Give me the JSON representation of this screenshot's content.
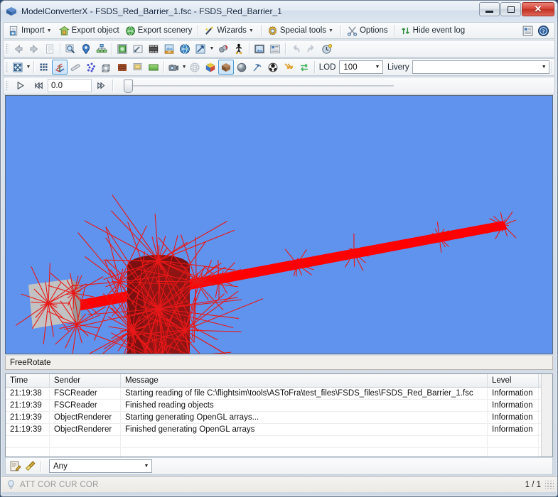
{
  "window": {
    "title": "ModelConverterX - FSDS_Red_Barrier_1.fsc - FSDS_Red_Barrier_1",
    "app_icon": "blue-cube-icon",
    "controls": {
      "minimize": "Minimize",
      "maximize": "Maximize",
      "close": "Close"
    }
  },
  "menubar": {
    "items": [
      {
        "label": "Import",
        "icon": "import-page-icon",
        "caret": true
      },
      {
        "label": "Export object",
        "icon": "export-object-icon",
        "caret": false
      },
      {
        "label": "Export scenery",
        "icon": "export-scenery-globe-icon",
        "caret": false
      },
      {
        "label": "Wizards",
        "icon": "wizard-wand-icon",
        "caret": true
      },
      {
        "label": "Special tools",
        "icon": "gear-icon",
        "caret": true
      },
      {
        "label": "Options",
        "icon": "options-scissors-icon",
        "caret": false
      },
      {
        "label": "Hide event log",
        "icon": "event-log-icon",
        "caret": false
      }
    ],
    "right_icons": [
      {
        "name": "report-icon"
      },
      {
        "name": "help-question-icon"
      }
    ]
  },
  "toolbar_row1": {
    "buttons": [
      {
        "name": "back-arrow-icon"
      },
      {
        "name": "forward-arrow-icon"
      },
      {
        "name": "document-list-icon"
      },
      {
        "sep": true
      },
      {
        "name": "zoom-inspect-icon"
      },
      {
        "name": "map-pin-icon"
      },
      {
        "name": "hierarchy-tree-icon"
      },
      {
        "sep": true
      },
      {
        "name": "texture-grid-icon"
      },
      {
        "name": "material-tool-icon"
      },
      {
        "name": "film-strip-icon"
      },
      {
        "name": "sdk-export-icon"
      },
      {
        "name": "globe-icon"
      },
      {
        "name": "scale-arrow-icon",
        "caret": true
      },
      {
        "name": "attach-points-icon"
      },
      {
        "name": "walk-person-icon"
      },
      {
        "sep": true
      },
      {
        "name": "image-preview-icon"
      },
      {
        "name": "properties-icon"
      },
      {
        "sep": true
      },
      {
        "name": "undo-arrow-icon"
      },
      {
        "name": "redo-arrow-icon"
      },
      {
        "name": "history-clock-icon"
      }
    ]
  },
  "toolbar_row2": {
    "buttons": [
      {
        "name": "fit-to-view-icon",
        "caret": true
      },
      {
        "sep": true
      },
      {
        "name": "grid-icon"
      },
      {
        "name": "axis-normals-icon",
        "active": true
      },
      {
        "name": "measure-ruler-icon"
      },
      {
        "name": "vertices-icon"
      },
      {
        "name": "wireframe-box-icon"
      },
      {
        "name": "brick-texture-icon"
      },
      {
        "name": "flat-color-icon"
      },
      {
        "name": "green-gradient-icon"
      },
      {
        "sep": true
      },
      {
        "name": "camera-icon",
        "caret": true
      },
      {
        "name": "mesh-sphere-icon"
      },
      {
        "name": "colored-cube-icon"
      },
      {
        "name": "shaded-cube-icon",
        "active": true
      },
      {
        "name": "sphere-shaded-icon"
      },
      {
        "name": "pick-tool-icon"
      },
      {
        "name": "checkered-ball-icon"
      },
      {
        "name": "double-arrow-icon"
      },
      {
        "name": "swap-arrows-icon"
      }
    ],
    "lod_label": "LOD",
    "lod_value": "100",
    "livery_label": "Livery",
    "livery_value": ""
  },
  "animation_bar": {
    "play_icon": "play-icon",
    "rewind_icon": "rewind-icon",
    "forward_icon": "fast-forward-icon",
    "time_value": "0.0",
    "slider_position": 0
  },
  "viewport": {
    "background_color": "#6093ed",
    "mode_label": "FreeRotate",
    "model_name": "FSDS_Red_Barrier_1",
    "colors": {
      "beam": "#ff0000",
      "cylinder": "#8c1212",
      "box": "#b8b8b8",
      "normals": "#e81818"
    }
  },
  "event_log": {
    "columns": [
      "Time",
      "Sender",
      "Message",
      "Level",
      ""
    ],
    "rows": [
      {
        "time": "21:19:38",
        "sender": "FSCReader",
        "message": "Starting reading of file C:\\flightsim\\tools\\ASToFra\\test_files\\FSDS_files\\FSDS_Red_Barrier_1.fsc",
        "level": "Information",
        "extra": ""
      },
      {
        "time": "21:19:39",
        "sender": "FSCReader",
        "message": "Finished reading objects",
        "level": "Information",
        "extra": ""
      },
      {
        "time": "21:19:39",
        "sender": "ObjectRenderer",
        "message": "Starting generating OpenGL arrays...",
        "level": "Information",
        "extra": ""
      },
      {
        "time": "21:19:39",
        "sender": "ObjectRenderer",
        "message": "Finished generating OpenGL arrays",
        "level": "Information",
        "extra": ""
      }
    ]
  },
  "filter_bar": {
    "icons": [
      {
        "name": "edit-note-icon"
      },
      {
        "name": "clear-broom-icon"
      }
    ],
    "level_filter_value": "Any"
  },
  "status_bar": {
    "icon": "lightbulb-icon",
    "text": "ATT COR  CUR COR",
    "page_count": "1 / 1"
  }
}
